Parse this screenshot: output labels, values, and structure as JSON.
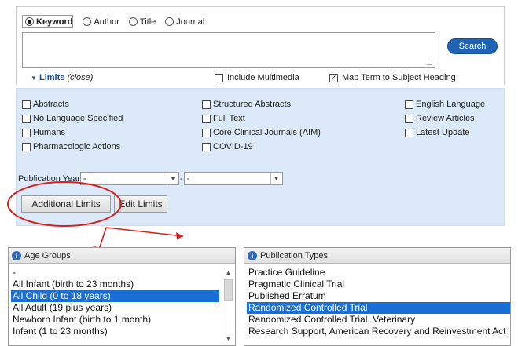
{
  "search": {
    "radios": [
      {
        "label": "Keyword",
        "selected": true
      },
      {
        "label": "Author",
        "selected": false
      },
      {
        "label": "Title",
        "selected": false
      },
      {
        "label": "Journal",
        "selected": false
      }
    ],
    "query_value": "",
    "search_button": "Search"
  },
  "limits": {
    "title": "Limits",
    "close": "(close)",
    "include_multimedia": {
      "label": "Include Multimedia",
      "checked": false
    },
    "map_term": {
      "label": "Map Term to Subject Heading",
      "checked": true
    },
    "col1": [
      "Abstracts",
      "No Language Specified",
      "Humans",
      "Pharmacologic Actions"
    ],
    "col2": [
      "Structured Abstracts",
      "Full Text",
      "Core Clinical Journals (AIM)",
      "COVID-19"
    ],
    "col3": [
      "English Language",
      "Review Articles",
      "Latest Update"
    ],
    "publication_year_label": "Publication Year",
    "year_from": "-",
    "year_to": "-",
    "year_separator": "-",
    "additional_limits": "Additional Limits",
    "edit_limits": "Edit Limits"
  },
  "age_groups": {
    "title": "Age Groups",
    "items": [
      "-",
      "All Infant (birth to 23 months)",
      "All Child (0 to 18 years)",
      "All Adult (19 plus years)",
      "Newborn Infant (birth to 1 month)",
      "Infant (1 to 23 months)"
    ],
    "selected_index": 2
  },
  "publication_types": {
    "title": "Publication Types",
    "items": [
      "Practice Guideline",
      "Pragmatic Clinical Trial",
      "Published Erratum",
      "Randomized Controlled Trial",
      "Randomized Controlled Trial, Veterinary",
      "Research Support, American Recovery and Reinvestment Act"
    ],
    "selected_index": 3
  },
  "colors": {
    "accent": "#1f63b5",
    "panel": "#dbe9f8",
    "highlight": "#1a6fd6",
    "annotation": "#d62020"
  }
}
